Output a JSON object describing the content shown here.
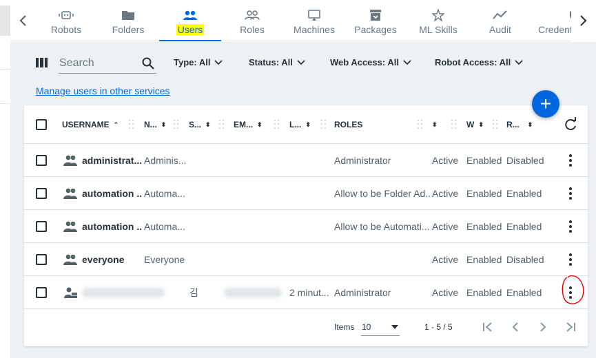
{
  "nav": {
    "tabs": [
      {
        "label": "Robots",
        "icon": "robot-icon"
      },
      {
        "label": "Folders",
        "icon": "folder-icon"
      },
      {
        "label": "Users",
        "icon": "users-icon",
        "active": true
      },
      {
        "label": "Roles",
        "icon": "roles-icon"
      },
      {
        "label": "Machines",
        "icon": "monitor-icon"
      },
      {
        "label": "Packages",
        "icon": "package-icon"
      },
      {
        "label": "ML Skills",
        "icon": "ml-skills-icon"
      },
      {
        "label": "Audit",
        "icon": "audit-icon"
      },
      {
        "label": "Credentia",
        "icon": "shield-icon"
      }
    ]
  },
  "filters": {
    "search_placeholder": "Search",
    "type": "Type: All",
    "status": "Status: All",
    "web_access": "Web Access: All",
    "robot_access": "Robot Access: All"
  },
  "manage_link": "Manage users in other services",
  "fab_label": "+",
  "table": {
    "headers": {
      "username": "USERNAME",
      "name": "N...",
      "surname": "S...",
      "email": "EM...",
      "last_login": "L...",
      "roles": "ROLES",
      "status": "",
      "web": "W",
      "robot": "R..."
    },
    "rows": [
      {
        "username": "administrat...",
        "name": "Adminis...",
        "surname": "",
        "last_login": "",
        "roles": "Administrator",
        "status": "Active",
        "web": "Enabled",
        "robot": "Disabled",
        "icon": "group-icon"
      },
      {
        "username": "automation ...",
        "name": "Automa...",
        "surname": "",
        "last_login": "",
        "roles": "Allow to be Folder Ad...",
        "status": "Active",
        "web": "Enabled",
        "robot": "Enabled",
        "icon": "group-icon"
      },
      {
        "username": "automation ...",
        "name": "Automa...",
        "surname": "",
        "last_login": "",
        "roles": "Allow to be Automati...",
        "status": "Active",
        "web": "Enabled",
        "robot": "Enabled",
        "icon": "group-icon"
      },
      {
        "username": "everyone",
        "name": "Everyone",
        "surname": "",
        "last_login": "",
        "roles": "",
        "status": "Active",
        "web": "Enabled",
        "robot": "Disabled",
        "icon": "group-icon"
      },
      {
        "username": "",
        "name": "",
        "surname": "김",
        "last_login": "2 minut...",
        "roles": "Administrator",
        "status": "Active",
        "web": "Enabled",
        "robot": "Enabled",
        "icon": "user-directory-icon"
      }
    ]
  },
  "pagination": {
    "items_label": "Items",
    "page_size": "10",
    "range": "1 - 5 / 5"
  },
  "colors": {
    "accent": "#0067df",
    "highlight": "#ffff00",
    "annotation": "#e00000",
    "background": "#eef1f4"
  }
}
